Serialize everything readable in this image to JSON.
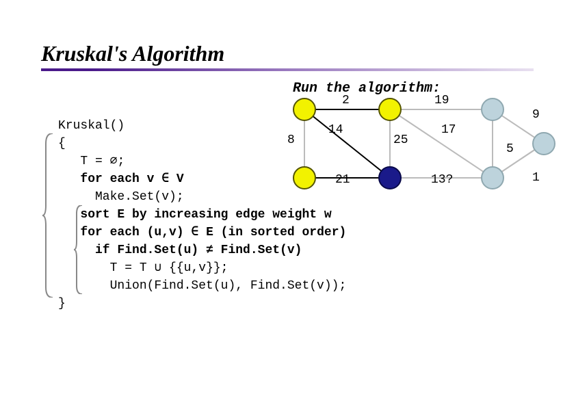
{
  "title": "Kruskal's Algorithm",
  "run_label": "Run the algorithm:",
  "code": {
    "l1": "Kruskal()",
    "l2": "{",
    "l3": "   T = ∅;",
    "l4": "   for each v ∈ V",
    "l5": "     Make.Set(v);",
    "l6": "   sort E by increasing edge weight w",
    "l7": "   for each (u,v) ∈ E (in sorted order)",
    "l8": "     if Find.Set(u) ≠ Find.Set(v)",
    "l9": "       T = T ∪ {{u,v}};",
    "l10": "       Union(Find.Set(u), Find.Set(v));",
    "l11": "}"
  },
  "graph": {
    "weights": {
      "w2": "2",
      "w19": "19",
      "w9": "9",
      "w14": "14",
      "w8": "8",
      "w25": "25",
      "w17": "17",
      "w5": "5",
      "w21": "21",
      "w13q": "13?",
      "w1": "1"
    }
  }
}
